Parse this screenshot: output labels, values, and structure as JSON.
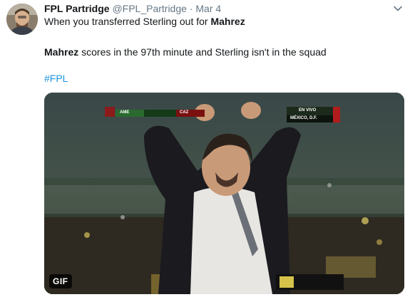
{
  "tweet": {
    "display_name": "FPL Partridge",
    "handle": "@FPL_Partridge",
    "separator": "·",
    "date": "Mar 4",
    "line1_prefix": "When you transferred Sterling out for ",
    "line1_bold": "Mahrez",
    "line2_bold": "Mahrez",
    "line2_rest": " scores in the 97th minute and Sterling isn't in the squad",
    "hashtag": "#FPL",
    "more_icon": "chevron-down-icon"
  },
  "media": {
    "badge": "GIF",
    "score_left": "AME",
    "score_right": "CAZ",
    "broadcast_top": "EN VIVO",
    "broadcast_bottom": "MÉXICO, D.F."
  },
  "colors": {
    "link": "#1b95e0",
    "secondary_text": "#657786",
    "primary_text": "#14171a"
  }
}
